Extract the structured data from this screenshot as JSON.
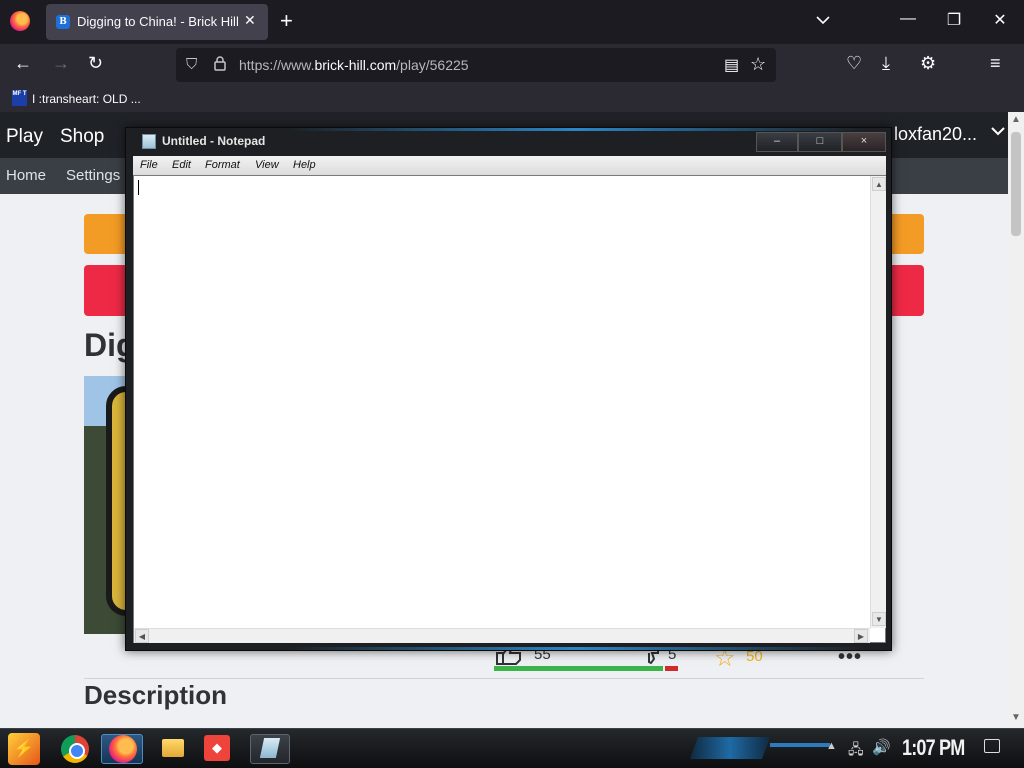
{
  "browser": {
    "tab": {
      "title": "Digging to China! - Brick Hill",
      "favicon": "B"
    },
    "url": {
      "prefix": "https://www.",
      "domain": "brick-hill.com",
      "path": "/play/56225"
    },
    "bookmark": {
      "icon": "MF T",
      "label": "I :transheart: OLD ..."
    },
    "icons": {
      "new_tab": "+",
      "tab_list": "⌄",
      "minimize": "—",
      "restore": "❐",
      "close": "✕",
      "back": "←",
      "forward": "→",
      "reload": "↻",
      "shield": "⛉",
      "lock": "🔒",
      "reader": "▤",
      "star": "☆",
      "pocket": "♡",
      "download": "⤓",
      "extensions": "⚙",
      "menu": "≡"
    }
  },
  "site": {
    "nav": [
      "Play",
      "Shop"
    ],
    "subnav": [
      "Home",
      "Settings"
    ],
    "username": "loxfan20...",
    "game_title": "Dig",
    "upvotes": "55",
    "downvotes": "5",
    "favorites": "50",
    "ratio": 0.92,
    "section": "Description"
  },
  "notepad": {
    "title": "Untitled - Notepad",
    "menu": [
      "File",
      "Edit",
      "Format",
      "View",
      "Help"
    ],
    "buttons": {
      "minimize": "–",
      "maximize": "□",
      "close": "×"
    },
    "content": ""
  },
  "taskbar": {
    "start": "⚡",
    "anydesk": "◆",
    "clock": "1:07 PM"
  },
  "colors": {
    "orange": "#f39c25",
    "red": "#ee2946",
    "brick_nav": "#1f2328"
  }
}
